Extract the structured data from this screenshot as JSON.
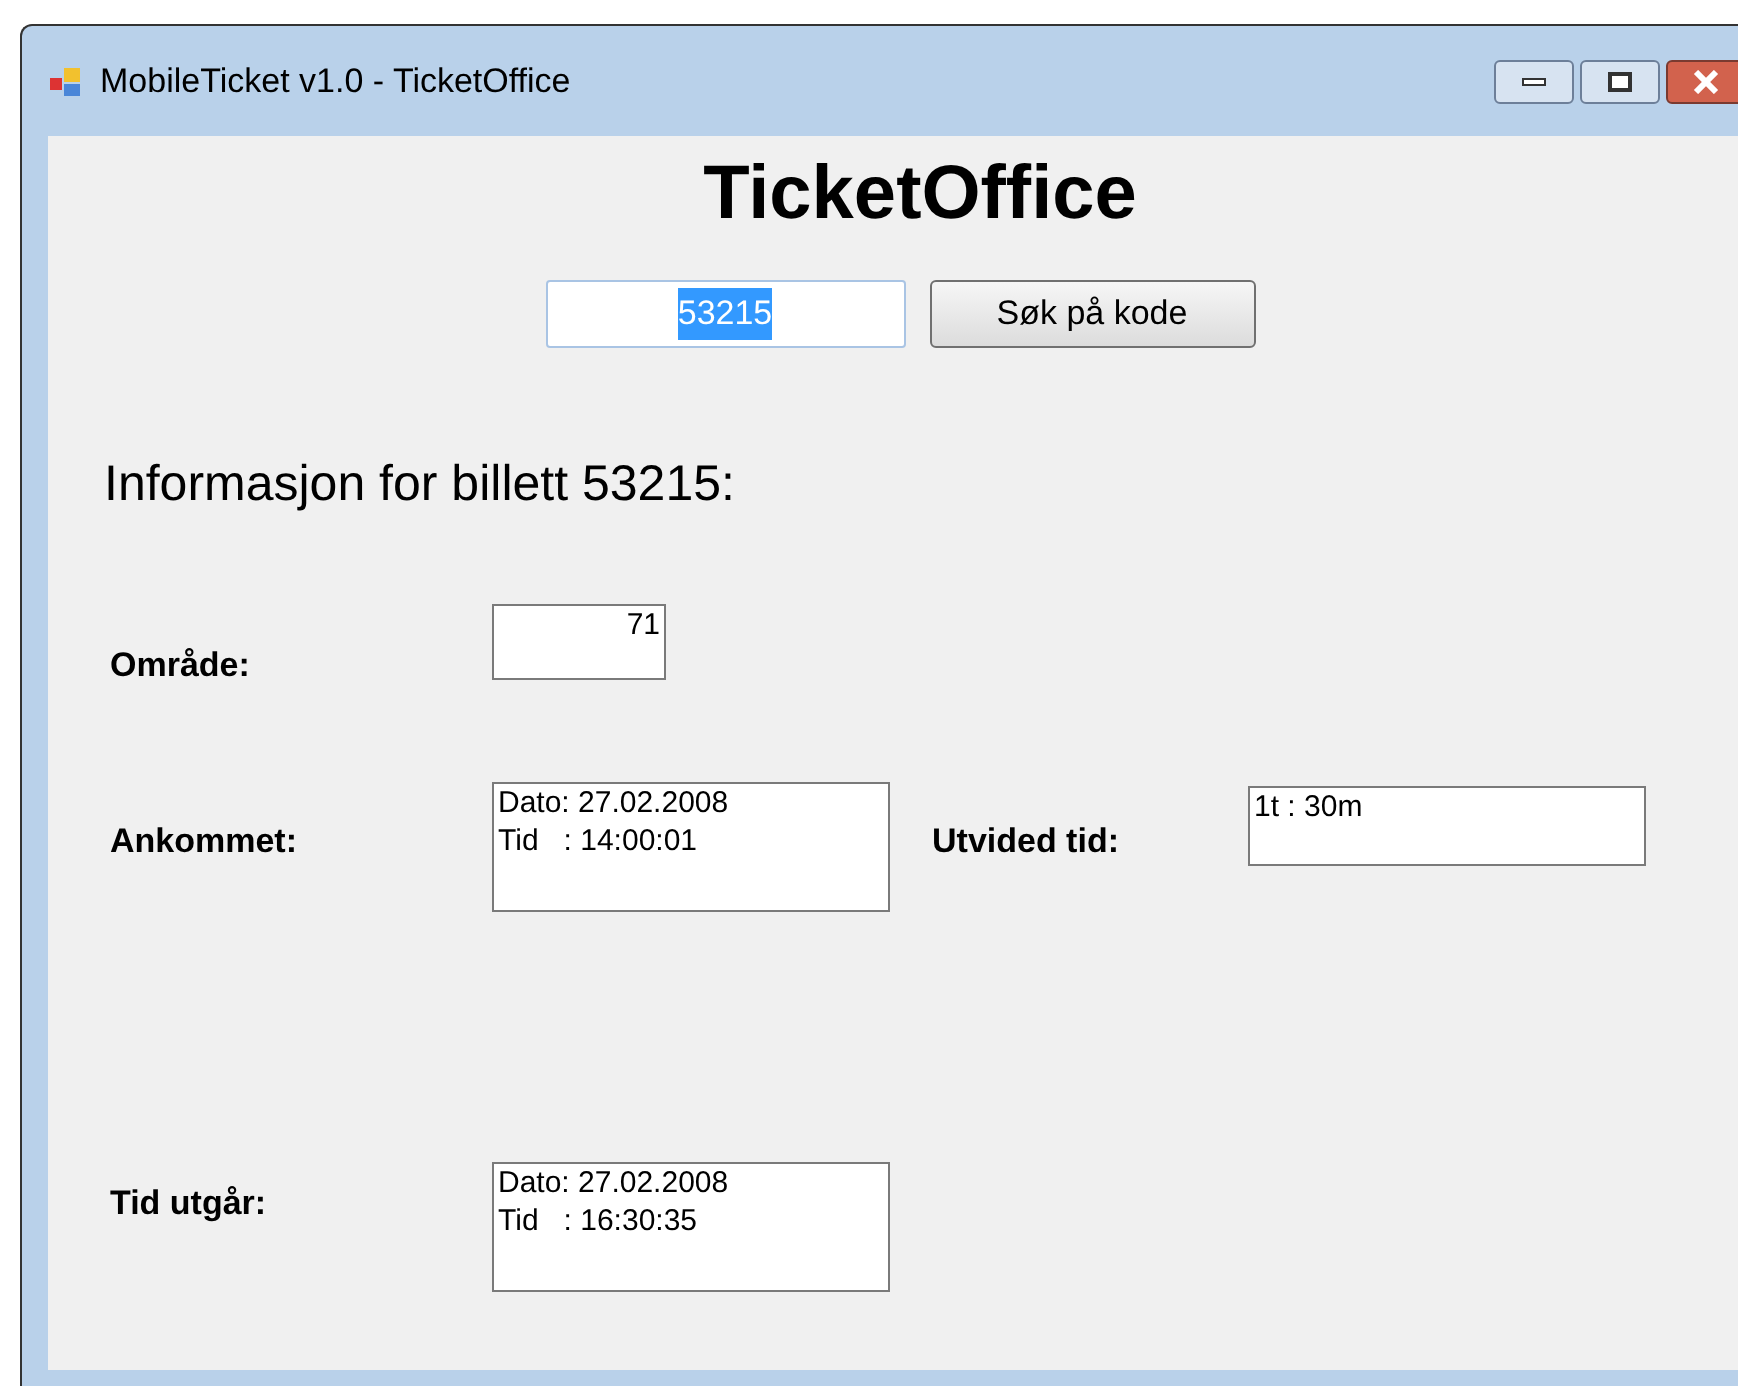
{
  "window": {
    "title": "MobileTicket v1.0 - TicketOffice"
  },
  "heading": "TicketOffice",
  "search": {
    "value": "53215",
    "selected": true,
    "button": "Søk på kode"
  },
  "info_title": "Informasjon for billett 53215:",
  "fields": [
    {
      "label": "Område:",
      "lines": [
        "71"
      ],
      "right_aligned": true
    },
    {
      "label": "Ankommet:",
      "lines": [
        "Dato: 27.02.2008",
        "Tid   : 14:00:01"
      ],
      "right_aligned": false
    },
    {
      "label": "Utvided tid:",
      "lines": [
        "1t : 30m"
      ],
      "right_aligned": false
    },
    {
      "label": "Tid utgår:",
      "lines": [
        "Dato: 27.02.2008",
        "Tid   : 16:30:35"
      ],
      "right_aligned": false
    }
  ]
}
